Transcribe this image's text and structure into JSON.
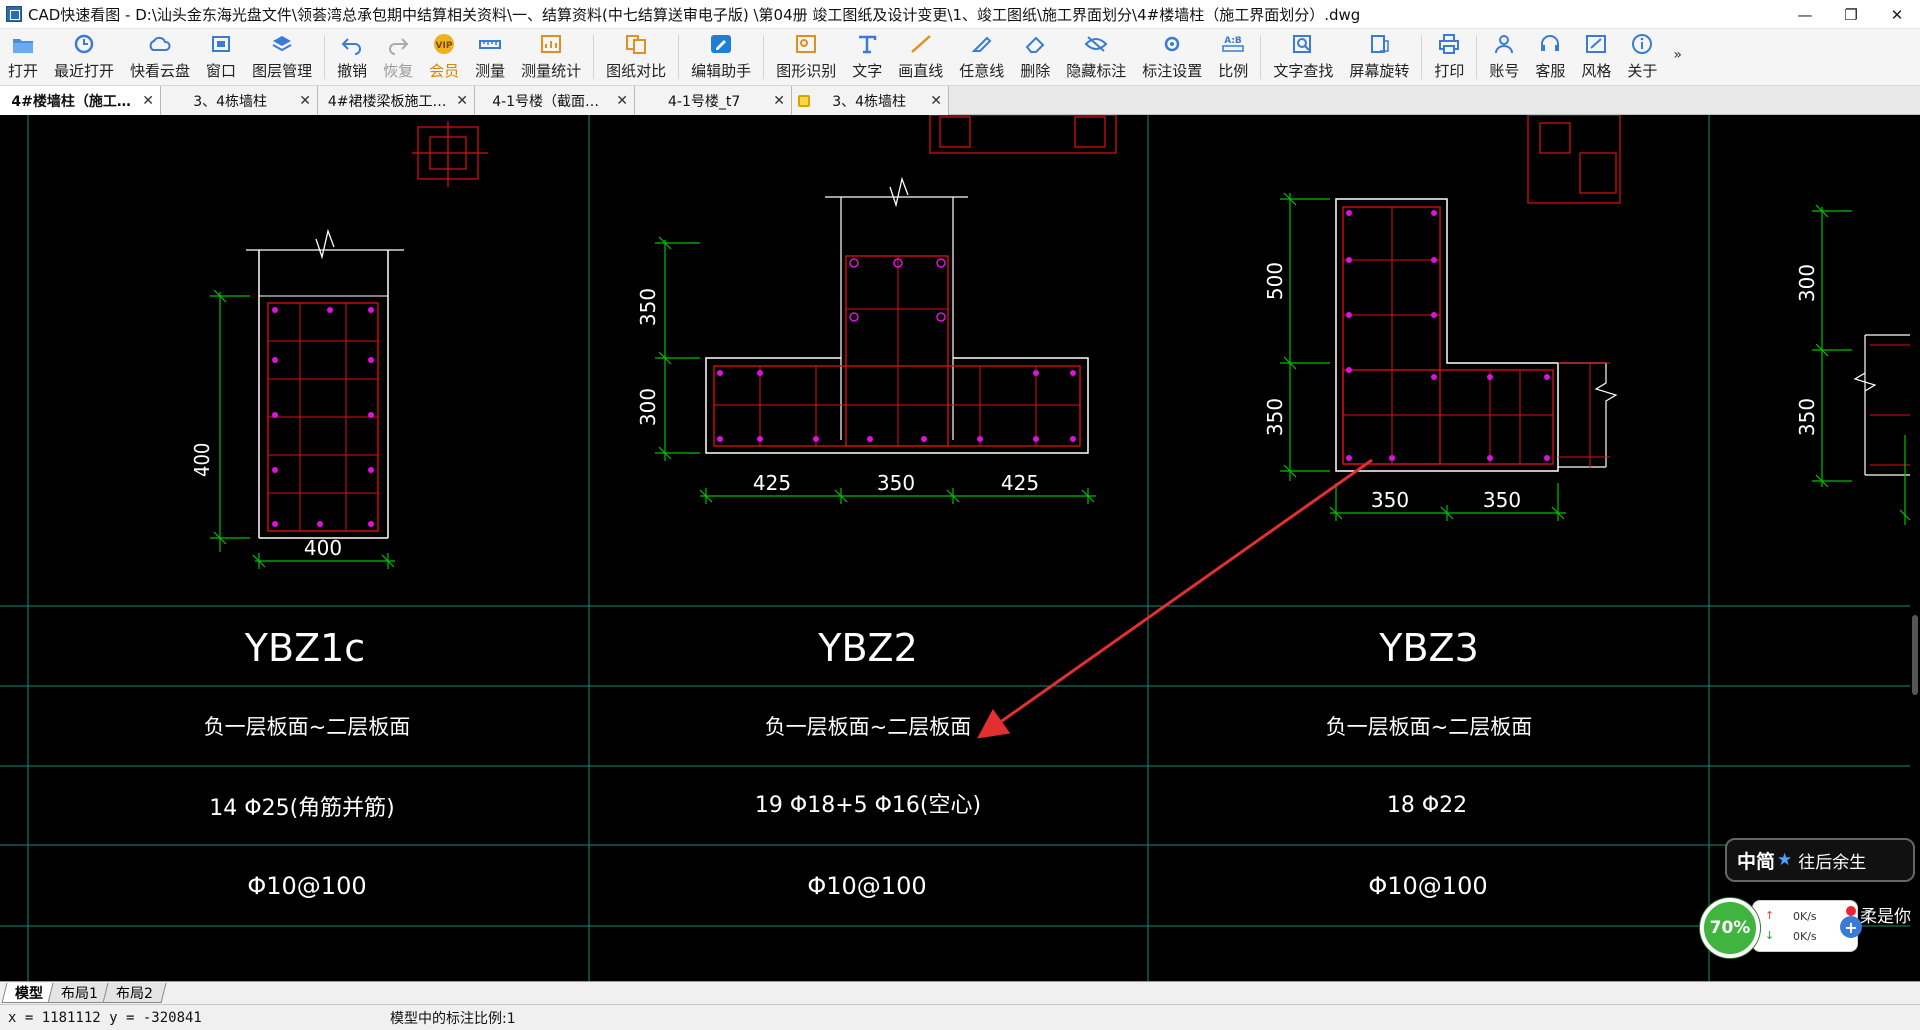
{
  "window": {
    "title": "CAD快速看图 - D:\\汕头金东海光盘文件\\领荟湾总承包期中结算相关资料\\一、结算资料(中七结算送审电子版) \\第04册  竣工图纸及设计变更\\1、竣工图纸\\施工界面划分\\4#楼墙柱（施工界面划分）.dwg",
    "minimize": "—",
    "restore": "❐",
    "close": "✕"
  },
  "toolbar": {
    "items": [
      {
        "label": "打开",
        "icon": "open-folder-icon"
      },
      {
        "label": "最近打开",
        "icon": "recent-clock-icon"
      },
      {
        "label": "快看云盘",
        "icon": "cloud-icon"
      },
      {
        "label": "窗口",
        "icon": "window-icon"
      },
      {
        "label": "图层管理",
        "icon": "layers-icon"
      },
      {
        "label": "撤销",
        "icon": "undo-icon"
      },
      {
        "label": "恢复",
        "icon": "redo-icon"
      },
      {
        "label": "会员",
        "icon": "vip-icon"
      },
      {
        "label": "测量",
        "icon": "measure-icon"
      },
      {
        "label": "测量统计",
        "icon": "measure-stats-icon"
      },
      {
        "label": "图纸对比",
        "icon": "compare-icon"
      },
      {
        "label": "编辑助手",
        "icon": "edit-assistant-icon"
      },
      {
        "label": "图形识别",
        "icon": "shape-recognize-icon"
      },
      {
        "label": "文字",
        "icon": "text-icon"
      },
      {
        "label": "画直线",
        "icon": "line-icon"
      },
      {
        "label": "任意线",
        "icon": "freehand-icon"
      },
      {
        "label": "删除",
        "icon": "eraser-icon"
      },
      {
        "label": "隐藏标注",
        "icon": "hide-annotation-icon"
      },
      {
        "label": "标注设置",
        "icon": "annotation-settings-icon"
      },
      {
        "label": "比例",
        "icon": "scale-icon"
      },
      {
        "label": "文字查找",
        "icon": "text-search-icon"
      },
      {
        "label": "屏幕旋转",
        "icon": "rotate-screen-icon"
      },
      {
        "label": "打印",
        "icon": "print-icon"
      },
      {
        "label": "账号",
        "icon": "account-icon"
      },
      {
        "label": "客服",
        "icon": "headset-icon"
      },
      {
        "label": "风格",
        "icon": "style-icon"
      },
      {
        "label": "关于",
        "icon": "info-icon"
      }
    ],
    "more": "»",
    "vip_text": "VIP",
    "scale_text": "A:B"
  },
  "tabs": [
    {
      "label": "4#楼墙柱（施工…",
      "close": "✕",
      "active": true
    },
    {
      "label": "3、4栋墙柱",
      "close": "✕"
    },
    {
      "label": "4#裙楼梁板施工…",
      "close": "✕"
    },
    {
      "label": "4-1号楼（截面…",
      "close": "✕"
    },
    {
      "label": "4-1号楼_t7",
      "close": "✕"
    },
    {
      "label": "3、4栋墙柱",
      "close": "✕",
      "locked": true
    }
  ],
  "drawing": {
    "col1": {
      "name": "YBZ1c",
      "level": "负一层板面~二层板面",
      "rebar": "14 Φ25(角筋并筋)",
      "stirrup": "Φ10@100",
      "dim_h": "400",
      "dim_w": "400"
    },
    "col2": {
      "name": "YBZ2",
      "level": "负一层板面~二层板面",
      "rebar": "19 Φ18+5 Φ16(空心)",
      "stirrup": "Φ10@100",
      "dim_h1": "350",
      "dim_h2": "300",
      "dim_w1": "425",
      "dim_w2": "350",
      "dim_w3": "425"
    },
    "col3": {
      "name": "YBZ3",
      "level": "负一层板面~二层板面",
      "rebar": "18 Φ22",
      "stirrup": "Φ10@100",
      "dim_h1": "500",
      "dim_h2": "350",
      "dim_w1": "350",
      "dim_w2": "350"
    },
    "col4": {
      "dim_h1": "300",
      "dim_h2": "350"
    },
    "colors": {
      "background": "#000000",
      "outline": "#ffffff",
      "rebar": "#e01010",
      "bar_point": "#e010e0",
      "dimension": "#00c000",
      "grid": "#1a8a7a",
      "text": "#ffffff",
      "arrow": "#e23030"
    }
  },
  "layout_tabs": [
    {
      "label": "模型",
      "active": true
    },
    {
      "label": "布局1"
    },
    {
      "label": "布局2"
    }
  ],
  "status": {
    "coords": "x = 1181112 y = -320841",
    "scale": "模型中的标注比例:1"
  },
  "overlay": {
    "tag_main": "中简",
    "tag_star": "★",
    "tag_sub": "往后余生",
    "percent": "70%",
    "up_arrow": "↑",
    "down_arrow": "↓",
    "up_speed": "0K/s",
    "down_speed": "0K/s",
    "plus": "+",
    "text": "柔是你"
  }
}
